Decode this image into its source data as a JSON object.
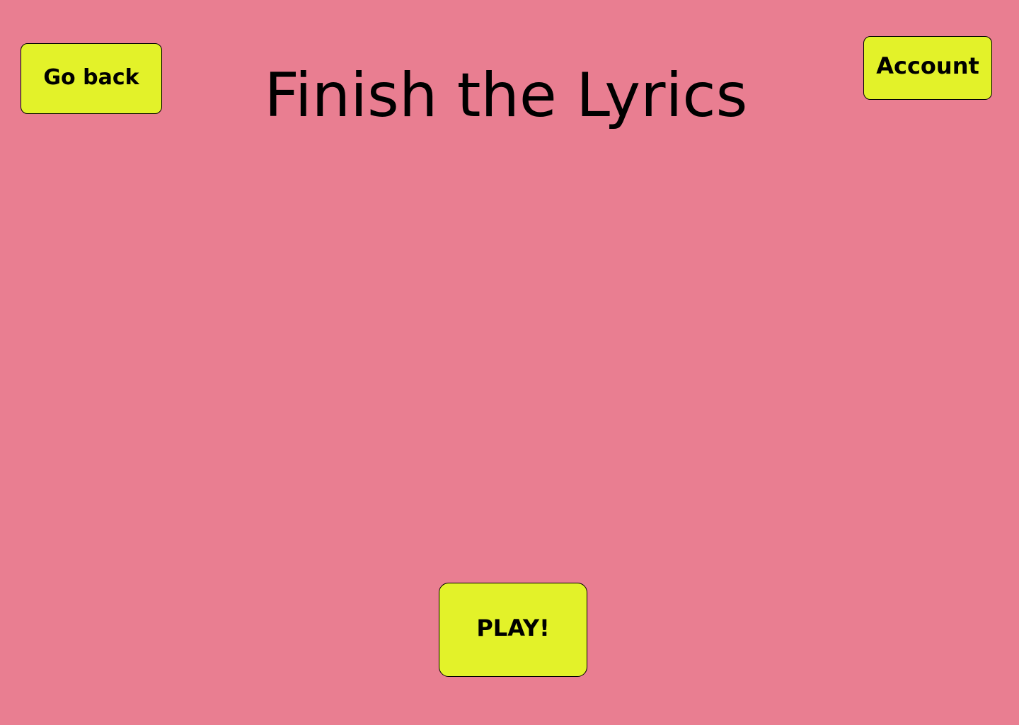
{
  "header": {
    "title": "Finish the Lyrics",
    "back_label": "Go back",
    "account_label": "Account"
  },
  "main": {
    "play_label": "PLAY!"
  },
  "colors": {
    "background": "#e97e91",
    "button_fill": "#e3f229",
    "text": "#000000"
  }
}
